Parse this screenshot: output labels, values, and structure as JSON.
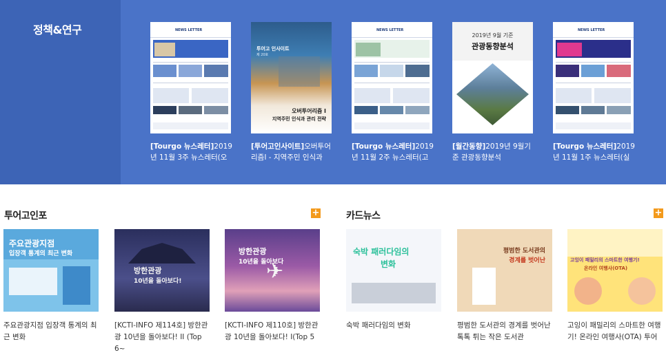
{
  "policy": {
    "title": "정책&연구",
    "items": [
      {
        "tag": "[Tourgo 뉴스레터]",
        "line1": "2019",
        "line2": "년 11월 3주 뉴스레터(오"
      },
      {
        "tag": "[투어고인사이트]",
        "line1": "오버투어",
        "line2": "리즘Ⅰ - 지역주민 인식과"
      },
      {
        "tag": "[Tourgo 뉴스레터]",
        "line1": "2019",
        "line2": "년 11월 2주 뉴스레터(고"
      },
      {
        "tag": "[월간동향]",
        "line1": "2019년 9월기",
        "line2": "준 관광동향분석"
      },
      {
        "tag": "[Tourgo 뉴스레터]",
        "line1": "2019",
        "line2": "년 11월 1주 뉴스레터(실"
      }
    ],
    "covers": {
      "newsletter_mast": "NEWS LETTER",
      "insight_top": "투어고 인사이트",
      "insight_issue": "제 20호",
      "insight_t1": "오버투어리즘 Ⅰ",
      "insight_t2": "지역주민 인식과 관리 전략",
      "monthly_t1": "2019년 9월 기준",
      "monthly_t2": "관광동향분석"
    }
  },
  "tourgo_info": {
    "title": "투어고인포",
    "more": "+",
    "items": [
      {
        "line1": "주요관광지점 입장객 통계의 최",
        "line2": "근 변화",
        "img_t1": "주요관광지점",
        "img_t2": "입장객 통계의 최근 변화"
      },
      {
        "line1": "[KCTI-INFO 제114호] 방한관",
        "line2": "광 10년을 돌아보다! II (Top 6~",
        "img_t1": "방한관광",
        "img_t2": "10년을 돌아보다!"
      },
      {
        "line1": "[KCTI-INFO 제110호] 방한관",
        "line2": "광 10년을 돌아보다! Ⅰ(Top 5",
        "img_t1": "방한관광",
        "img_t2": "10년을 돌아보다"
      }
    ]
  },
  "card_news": {
    "title": "카드뉴스",
    "more": "+",
    "items": [
      {
        "line1": "숙박 패러다임의 변화",
        "line2": "",
        "img_t1": "숙박 패러다임의",
        "img_t2": "변화"
      },
      {
        "line1": "평범한 도서관의 경계를 벗어난",
        "line2": "톡톡 튀는 작은 도서관",
        "img_t1": "평범한 도서관의",
        "img_t2": "경계를 벗어난"
      },
      {
        "line1": "고잉이 패밀리의 스마트한 여행",
        "line2": "기! 온라인 여행사(OTA) 투어",
        "img_t1": "고잉이 패밀리의 스마트한 여행기!",
        "img_t2": "온라인 여행사(OTA)"
      }
    ]
  },
  "colors": {
    "top_bg": "#4a73c8",
    "top_left_bg": "#3d64b6",
    "accent": "#f39a1c"
  }
}
